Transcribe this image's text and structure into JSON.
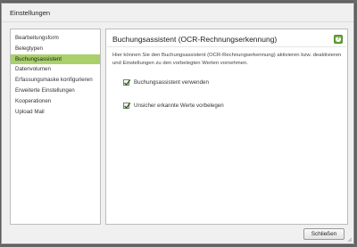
{
  "window": {
    "title": "Einstellungen"
  },
  "sidebar": {
    "items": [
      {
        "label": "Bearbeitungsform",
        "active": false
      },
      {
        "label": "Belegtypen",
        "active": false
      },
      {
        "label": "Buchungsassistent",
        "active": true
      },
      {
        "label": "Datenvolumen",
        "active": false
      },
      {
        "label": "Erfassungsmaske konfigurieren",
        "active": false
      },
      {
        "label": "Erweiterte Einstellungen",
        "active": false
      },
      {
        "label": "Kooperationen",
        "active": false
      },
      {
        "label": "Upload Mail",
        "active": false
      }
    ]
  },
  "content": {
    "title": "Buchungsassistent (OCR-Rechnungserkennung)",
    "help_icon": "help-icon",
    "description": "Hier können Sie den Buchungsassistent (OCR-Rechnungserkennung) aktivieren bzw. deaktivieren und Einstellungen zu den vorbelegten Werten vornehmen.",
    "options": [
      {
        "label": "Buchungsassistent verwenden",
        "checked": true
      },
      {
        "label": "Unsicher erkannte Werte vorbelegen",
        "checked": true
      }
    ]
  },
  "footer": {
    "close_label": "Schließen"
  },
  "colors": {
    "active_item": "#a9d06a",
    "help_icon": "#6ca73b"
  }
}
